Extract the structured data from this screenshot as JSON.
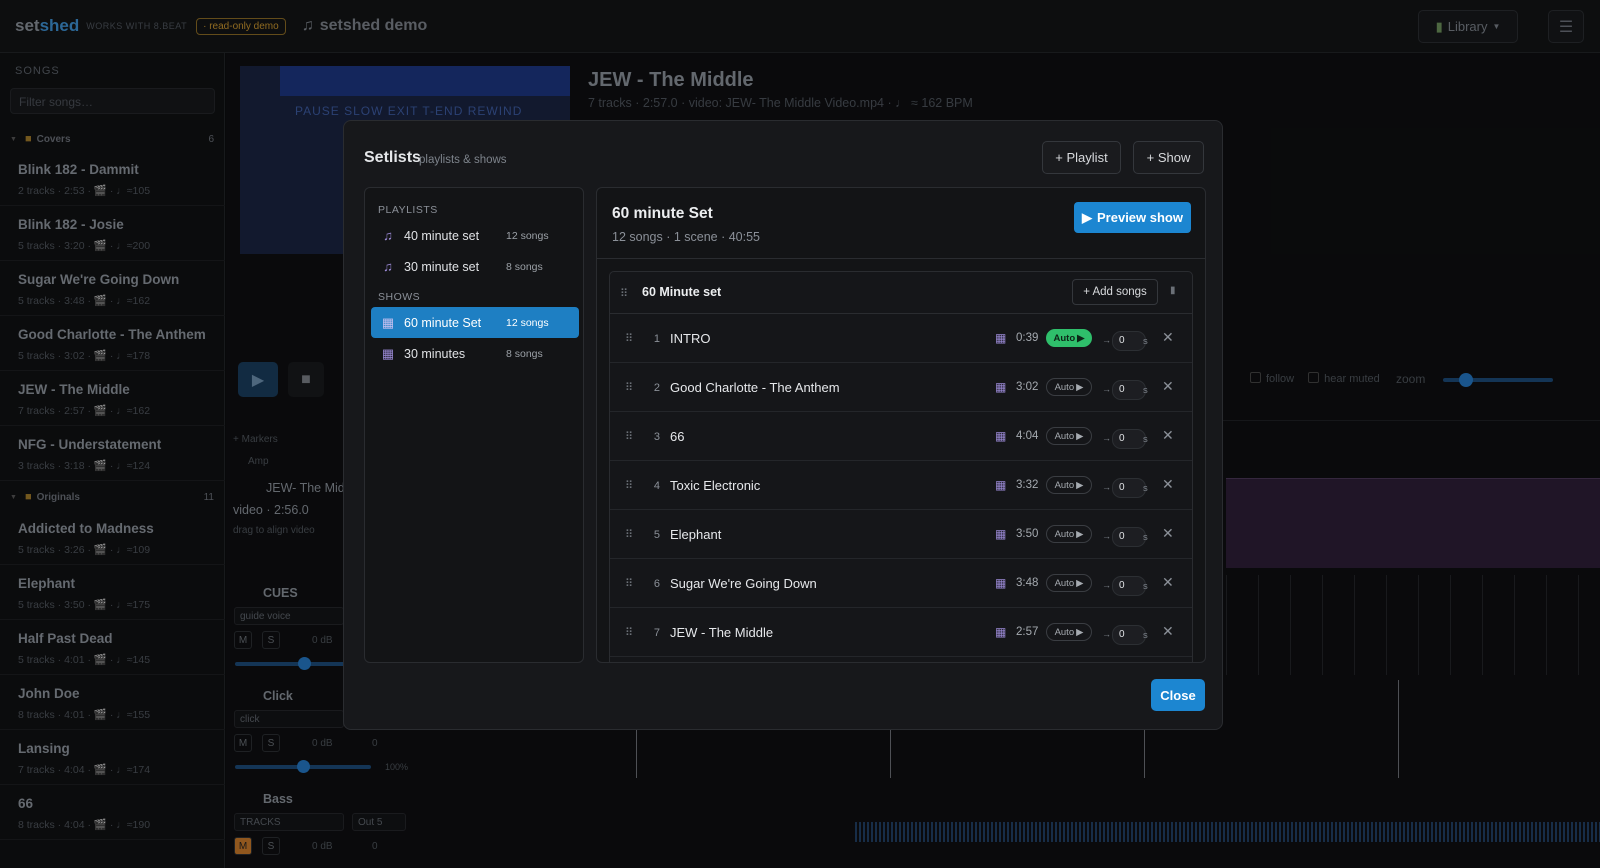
{
  "app": {
    "brand_a": "set",
    "brand_b": "shed",
    "works_with": "WORKS WITH 8.BEAT",
    "badge": "· read-only demo",
    "demo_title": "setshed demo",
    "library_label": "Library"
  },
  "sidebar": {
    "title": "SONGS",
    "filter_placeholder": "Filter songs…",
    "folders": [
      {
        "name": "Covers",
        "count": "6"
      },
      {
        "name": "Originals",
        "count": "11"
      }
    ],
    "songs": [
      {
        "title": "Blink 182 - Dammit",
        "meta": "2 tracks · 2:53 · 🎬 · ♩≈105"
      },
      {
        "title": "Blink 182 - Josie",
        "meta": "5 tracks · 3:20 · 🎬 · ♩≈200"
      },
      {
        "title": "Sugar We're Going Down",
        "meta": "5 tracks · 3:48 · 🎬 · ♩≈162"
      },
      {
        "title": "Good Charlotte - The Anthem",
        "meta": "5 tracks · 3:02 · 🎬 · ♩≈178"
      },
      {
        "title": "JEW - The Middle",
        "meta": "7 tracks · 2:57 · 🎬 · ♩≈162"
      },
      {
        "title": "NFG - Understatement",
        "meta": "3 tracks · 3:18 · 🎬 · ♩≈124"
      },
      {
        "title": "Addicted to Madness",
        "meta": "5 tracks · 3:26 · 🎬 · ♩≈109"
      },
      {
        "title": "Elephant",
        "meta": "5 tracks · 3:50 · 🎬 · ♩≈175"
      },
      {
        "title": "Half Past Dead",
        "meta": "5 tracks · 4:01 · 🎬 · ♩≈145"
      },
      {
        "title": "John Doe",
        "meta": "8 tracks · 4:01 · 🎬 · ♩≈155"
      },
      {
        "title": "Lansing",
        "meta": "7 tracks · 4:04 · 🎬 · ♩≈174"
      },
      {
        "title": "66",
        "meta": "8 tracks · 4:04 · 🎬 · ♩≈190"
      }
    ]
  },
  "song_view": {
    "title": "JEW - The Middle",
    "subtitle": "7 tracks · 2:57.0 · video: JEW- The Middle Video.mp4 · ♩ ≈ 162 BPM",
    "video_text": "PAUSE   SLOW   EXIT   T-END   REWIND",
    "markers_label": "+ Markers",
    "amp_label": "Amp",
    "video_track": "JEW- The Mid",
    "video_dur": "video · 2:56.0",
    "drag_hint": "drag to align video",
    "follow_label": "follow",
    "hear_muted_label": "hear muted",
    "zoom_label": "zoom",
    "zoom_level": 0.15,
    "tracks": [
      {
        "name": "CUES",
        "select": "guide voice",
        "db": "0 dB",
        "volume": 0.6
      },
      {
        "name": "Click",
        "select": "click",
        "db": "0 dB",
        "pan": "0",
        "pct": "100%",
        "volume": 0.5
      },
      {
        "name": "Bass",
        "select": "TRACKS",
        "out": "Out 5",
        "db": "0 dB",
        "pan": "0"
      }
    ]
  },
  "modal": {
    "title": "Setlists",
    "subtitle": "playlists & shows",
    "add_playlist": "+ Playlist",
    "add_show": "+ Show",
    "playlists_header": "PLAYLISTS",
    "shows_header": "SHOWS",
    "playlists": [
      {
        "name": "40 minute set",
        "count": "12 songs"
      },
      {
        "name": "30 minute set",
        "count": "8 songs"
      }
    ],
    "shows": [
      {
        "name": "60 minute Set",
        "count": "12 songs"
      },
      {
        "name": "30 minutes",
        "count": "8 songs"
      }
    ],
    "selected": {
      "title": "60 minute Set",
      "sub": "12 songs · 1 scene · 40:55",
      "preview_label": "Preview show",
      "scene_name": "60 Minute set",
      "add_songs": "+ Add songs",
      "rows": [
        {
          "n": "1",
          "title": "INTRO",
          "dur": "0:39",
          "auto": "Auto",
          "auto_on": true,
          "secs": "0"
        },
        {
          "n": "2",
          "title": "Good Charlotte - The Anthem",
          "dur": "3:02",
          "auto": "Auto",
          "auto_on": false,
          "secs": "0"
        },
        {
          "n": "3",
          "title": "66",
          "dur": "4:04",
          "auto": "Auto",
          "auto_on": false,
          "secs": "0"
        },
        {
          "n": "4",
          "title": "Toxic Electronic",
          "dur": "3:32",
          "auto": "Auto",
          "auto_on": false,
          "secs": "0"
        },
        {
          "n": "5",
          "title": "Elephant",
          "dur": "3:50",
          "auto": "Auto",
          "auto_on": false,
          "secs": "0"
        },
        {
          "n": "6",
          "title": "Sugar We're Going Down",
          "dur": "3:48",
          "auto": "Auto",
          "auto_on": false,
          "secs": "0"
        },
        {
          "n": "7",
          "title": "JEW - The Middle",
          "dur": "2:57",
          "auto": "Auto",
          "auto_on": false,
          "secs": "0"
        }
      ]
    },
    "close_label": "Close",
    "seconds_unit": "s"
  }
}
